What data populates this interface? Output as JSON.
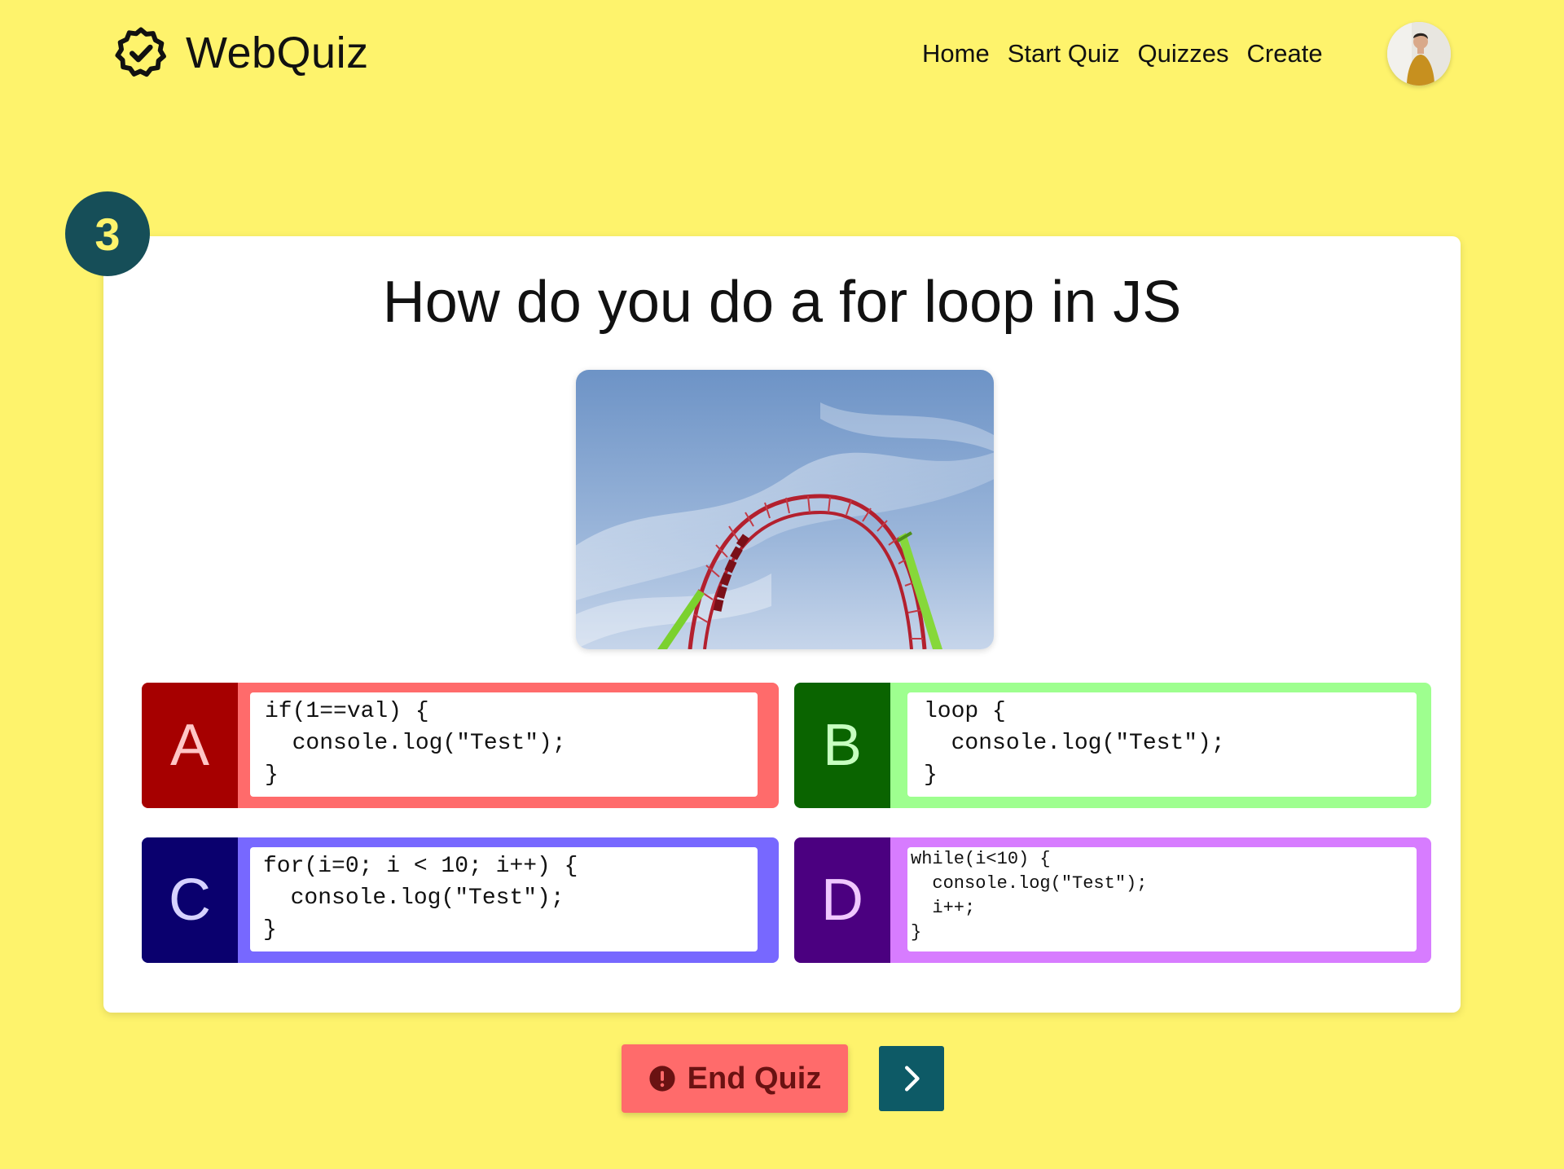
{
  "header": {
    "brand_name": "WebQuiz",
    "brand_icon": "verified-badge-icon",
    "nav": [
      {
        "label": "Home"
      },
      {
        "label": "Start Quiz"
      },
      {
        "label": "Quizzes"
      },
      {
        "label": "Create"
      }
    ],
    "avatar": "user-avatar"
  },
  "quiz": {
    "question_number": "3",
    "question": "How do you do a for loop in JS",
    "image": "roller-coaster-loop-photo",
    "answers": [
      {
        "letter": "A",
        "code": "if(1==val) {\n  console.log(\"Test\");\n}",
        "color": "#ff6b6b",
        "accent": "#a60000"
      },
      {
        "letter": "B",
        "code": "loop {\n  console.log(\"Test\");\n}",
        "color": "#9eff8f",
        "accent": "#0a6400"
      },
      {
        "letter": "C",
        "code": "for(i=0; i < 10; i++) {\n  console.log(\"Test\");\n}",
        "color": "#7768ff",
        "accent": "#0a006e"
      },
      {
        "letter": "D",
        "code": "while(i<10) {\n  console.log(\"Test\");\n  i++;\n}",
        "color": "#d77cff",
        "accent": "#4b0080"
      }
    ]
  },
  "actions": {
    "end_quiz_label": "End Quiz",
    "end_quiz_icon": "alert-circle-icon",
    "next_icon": "chevron-right-icon"
  },
  "colors": {
    "background": "#fef36c",
    "badge": "#164e58",
    "next_button": "#0d5a66"
  }
}
